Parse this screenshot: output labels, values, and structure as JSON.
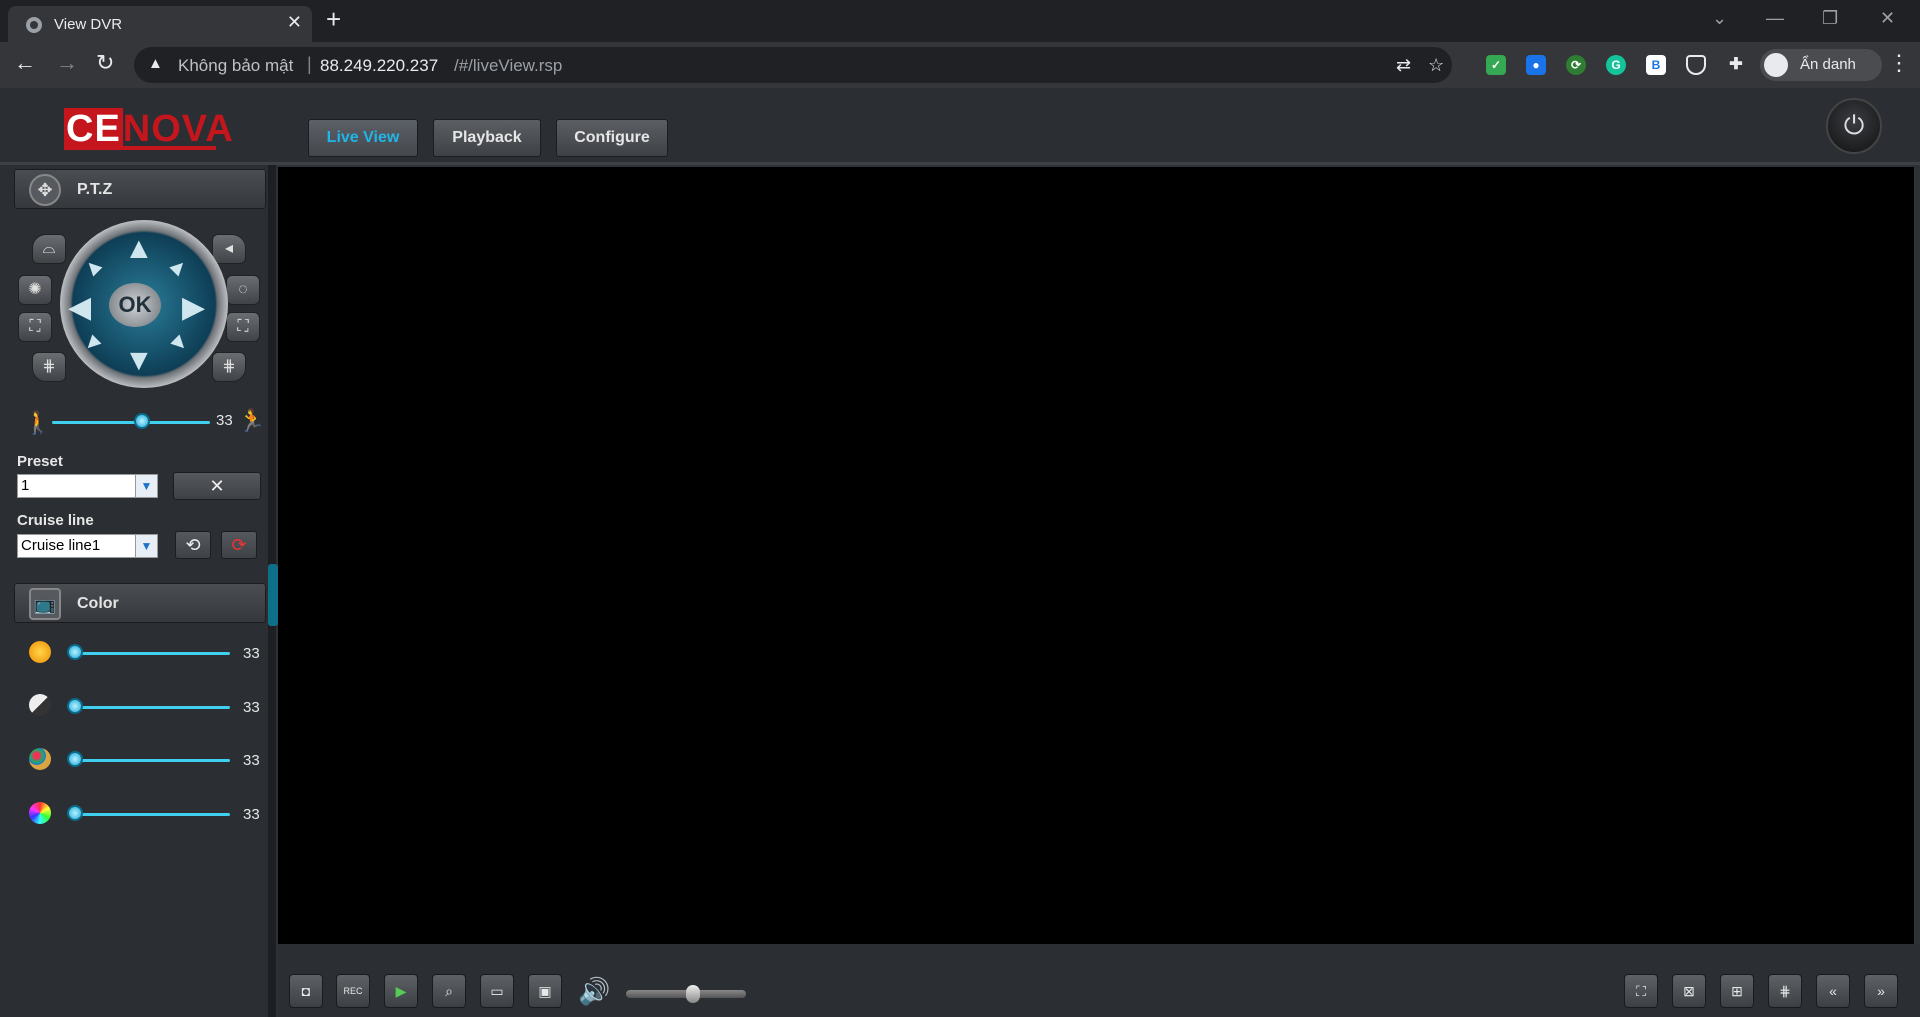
{
  "browser": {
    "tab_title": "View DVR",
    "tab_close": "✕",
    "new_tab": "+",
    "back": "←",
    "forward": "→",
    "reload": "↻",
    "security_label": "Không bảo mật",
    "separator": "|",
    "url_host": "88.249.220.237",
    "url_path": "/#/liveView.rsp",
    "profile_label": "Ẩn danh",
    "menu": "⋮",
    "window_controls": {
      "tabsearch": "⌄",
      "minimize": "—",
      "restore": "❐",
      "close": "✕"
    }
  },
  "app": {
    "logo_ce": "CE",
    "logo_nova": "NOVA",
    "nav": [
      {
        "label": "Live View",
        "active": true
      },
      {
        "label": "Playback",
        "active": false
      },
      {
        "label": "Configure",
        "active": false
      }
    ],
    "power_icon": "⏻"
  },
  "ptz": {
    "title": "P.T.Z",
    "ok_label": "OK",
    "speed_value": "33",
    "preset_label": "Preset",
    "preset_value": "1",
    "cruise_label": "Cruise line",
    "cruise_value": "Cruise line1"
  },
  "color": {
    "title": "Color",
    "items": [
      {
        "name": "brightness",
        "value": "33",
        "level": 0
      },
      {
        "name": "contrast",
        "value": "33",
        "level": 0
      },
      {
        "name": "saturation",
        "value": "33",
        "level": 0
      },
      {
        "name": "hue",
        "value": "33",
        "level": 0
      }
    ]
  },
  "theme": {
    "accent": "#1fb6e8",
    "logo_red": "#c4161c",
    "video_bg": "#000000"
  }
}
